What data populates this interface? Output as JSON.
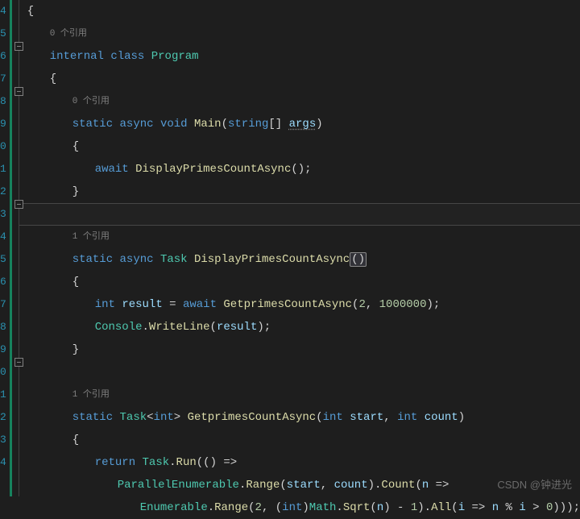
{
  "gutter": [
    "4",
    "5",
    "6",
    "7",
    "8",
    "9",
    "0",
    "1",
    "2",
    "3",
    "4",
    "5",
    "6",
    "7",
    "8",
    "9",
    "0",
    "1",
    "2",
    "3",
    "4"
  ],
  "codelens": {
    "zero": "0 个引用",
    "one": "1 个引用"
  },
  "code": {
    "internal": "internal",
    "class": "class",
    "Program": "Program",
    "static": "static",
    "async": "async",
    "void": "void",
    "Task": "Task",
    "Main": "Main",
    "string": "string",
    "args": "args",
    "await": "await",
    "DisplayPrimesCountAsync": "DisplayPrimesCountAsync",
    "int": "int",
    "result": "result",
    "GetprimesCountAsync": "GetprimesCountAsync",
    "two": "2",
    "million": "1000000",
    "Console": "Console",
    "WriteLine": "WriteLine",
    "start": "start",
    "count": "count",
    "return": "return",
    "Run": "Run",
    "ParallelEnumerable": "ParallelEnumerable",
    "Range": "Range",
    "Count": "Count",
    "n": "n",
    "Enumerable": "Enumerable",
    "Math": "Math",
    "Sqrt": "Sqrt",
    "one": "1",
    "All": "All",
    "i": "i",
    "zero": "0"
  },
  "fold": {
    "pos1": 52,
    "pos2": 108,
    "pos3": 248,
    "pos4": 444
  },
  "watermark": "CSDN @钟进光"
}
